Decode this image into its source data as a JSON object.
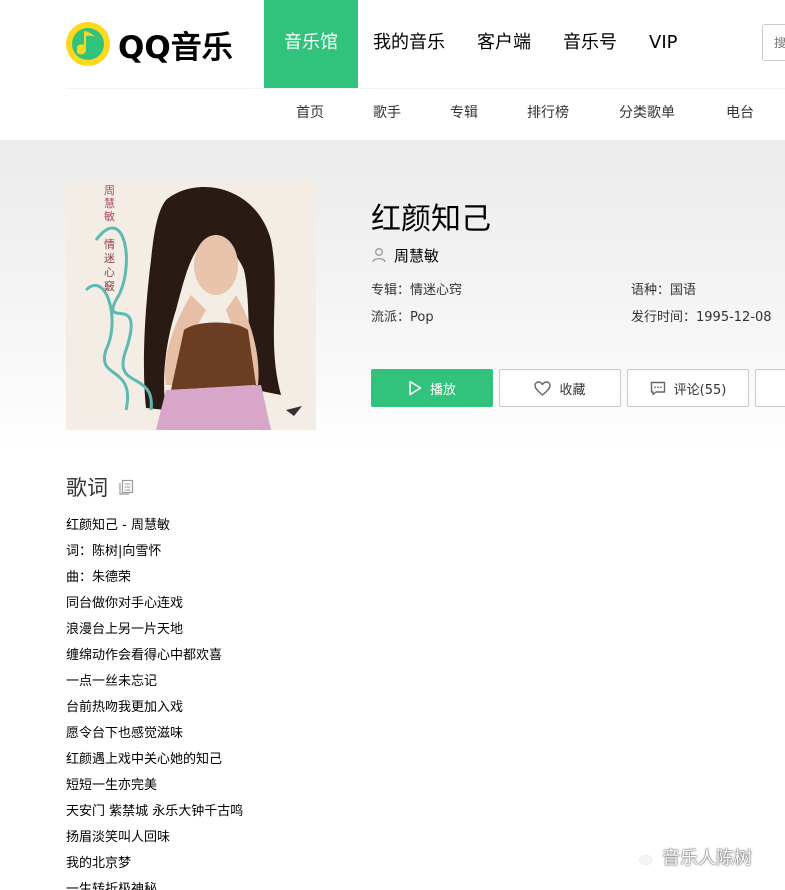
{
  "header": {
    "logo_text": "QQ音乐",
    "nav": [
      {
        "label": "音乐馆",
        "active": true
      },
      {
        "label": "我的音乐",
        "active": false
      },
      {
        "label": "客户端",
        "active": false
      },
      {
        "label": "音乐号",
        "active": false
      },
      {
        "label": "VIP",
        "active": false
      }
    ],
    "search_placeholder": "搜索"
  },
  "subnav": [
    "首页",
    "歌手",
    "专辑",
    "排行榜",
    "分类歌单",
    "电台"
  ],
  "song": {
    "title": "红颜知己",
    "singer": "周慧敏",
    "album": "专辑：情迷心窍",
    "genre": "流派：Pop",
    "language": "语种：国语",
    "release": "发行时间：1995-12-08",
    "cover_text_artist": "周慧敏",
    "cover_text_album": "情迷心竅"
  },
  "actions": {
    "play": "播放",
    "favorite": "收藏",
    "comment": "评论(55)"
  },
  "lyrics": {
    "heading": "歌词",
    "lines": [
      "红颜知己 - 周慧敏",
      "词：陈树|向雪怀",
      "曲：朱德荣",
      "同台做你对手心连戏",
      "浪漫台上另一片天地",
      "缠绵动作会看得心中都欢喜",
      "一点一丝未忘记",
      "台前热吻我更加入戏",
      "愿令台下也感觉滋味",
      "红颜遇上戏中关心她的知己",
      "短短一生亦完美",
      "天安门 紫禁城 永乐大钟千古鸣",
      "扬眉淡笑叫人回味",
      "我的北京梦",
      "一生转折极神秘"
    ]
  },
  "watermark": "音乐人陈树",
  "colors": {
    "brand_green": "#31c27c",
    "logo_yellow": "#ffd71b"
  }
}
